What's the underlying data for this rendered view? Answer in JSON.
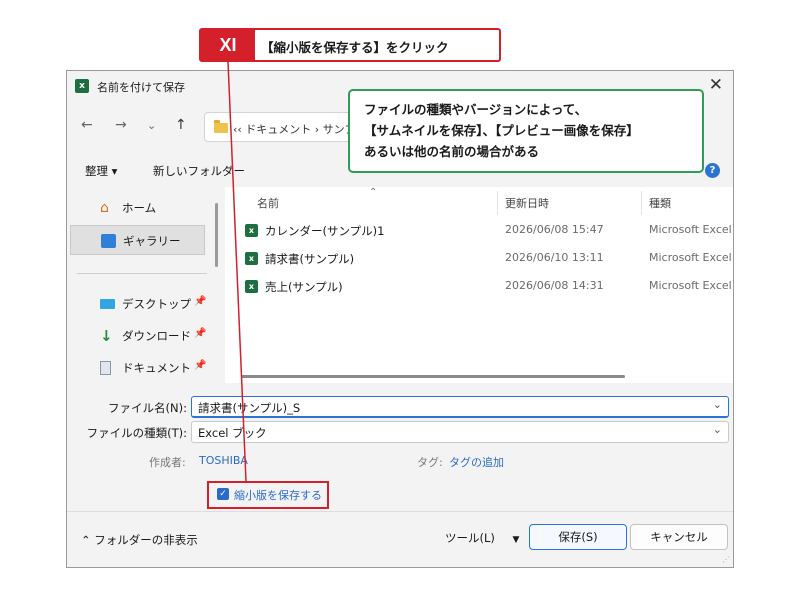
{
  "annotation": {
    "step_number": "XI",
    "step_text": "【縮小版を保存する】をクリック",
    "note_lines": [
      "ファイルの種類やバージョンによって、",
      "【サムネイルを保存】、【プレビュー画像を保存】",
      "あるいは他の名前の場合がある"
    ]
  },
  "dialog": {
    "title": "名前を付けて保存",
    "close_glyph": "✕",
    "app_icon_letter": "x",
    "address": "‹‹ ドキュメント ›  サンプ",
    "toolbar": {
      "organize": "整理 ▾",
      "new_folder": "新しいフォルダー",
      "help": "?"
    },
    "nav": [
      {
        "label": "ホーム",
        "icon": "home-icon"
      },
      {
        "label": "ギャラリー",
        "icon": "gallery-icon",
        "selected": true
      },
      {
        "label": "デスクトップ",
        "icon": "desktop-icon",
        "pin": "📌"
      },
      {
        "label": "ダウンロード",
        "icon": "download-icon",
        "pin": "📌"
      },
      {
        "label": "ドキュメント",
        "icon": "document-icon",
        "pin": "📌"
      }
    ],
    "columns": {
      "name": "名前",
      "date": "更新日時",
      "type": "種類"
    },
    "files": [
      {
        "name": "カレンダー(サンプル)1",
        "date": "2026/06/08 15:47",
        "type": "Microsoft Excel"
      },
      {
        "name": "請求書(サンプル)",
        "date": "2026/06/10 13:11",
        "type": "Microsoft Excel"
      },
      {
        "name": "売上(サンプル)",
        "date": "2026/06/08 14:31",
        "type": "Microsoft Excel"
      }
    ],
    "filename_label": "ファイル名(N):",
    "filename_value": "請求書(サンプル)_S",
    "filetype_label": "ファイルの種類(T):",
    "filetype_value": "Excel ブック",
    "author_label": "作成者:",
    "author_value": "TOSHIBA",
    "tags_label": "タグ:",
    "tags_value": "タグの追加",
    "thumbnail_checkbox": {
      "label": "縮小版を保存する",
      "checked": true
    },
    "hide_folders": "フォルダーの非表示",
    "tools": "ツール(L)",
    "save": "保存(S)",
    "cancel": "キャンセル"
  }
}
